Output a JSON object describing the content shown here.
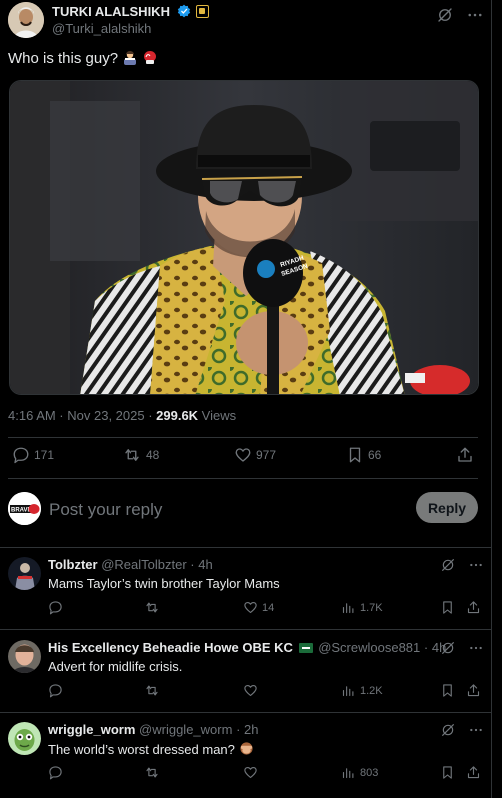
{
  "post": {
    "author_name": "TURKI ALALSHIKH",
    "author_handle": "@Turki_alalshikh",
    "text": "Who is this guy?",
    "timestamp": "4:16 AM · Nov 23, 2025 · ",
    "views_count": "299.6K",
    "views_label": " Views",
    "replies": "171",
    "reposts": "48",
    "likes": "977",
    "bookmarks": "66",
    "photo_caption": "RIYADH SEASON"
  },
  "composer": {
    "placeholder": "Post your reply",
    "reply_button": "Reply",
    "avatar_text": "BRAVE"
  },
  "replies": [
    {
      "name": "Tolbzter",
      "handle": "@RealTolbzter",
      "time": "· 4h",
      "text": "Mams Taylor’s twin brother Taylor Mams",
      "likes": "14",
      "views": "1.7K"
    },
    {
      "name": "His Excellency Beheadie Howe OBE KC",
      "handle": "@Screwloose881",
      "time": "· 4h",
      "text": "Advert for midlife crisis.",
      "likes": "",
      "views": "1.2K"
    },
    {
      "name": "wriggle_worm",
      "handle": "@wriggle_worm",
      "time": "· 2h",
      "text": "The world’s worst dressed man?",
      "likes": "",
      "views": "803"
    }
  ],
  "colors": {
    "background": "#000000",
    "text": "#e7e9ea",
    "muted": "#71767b",
    "verified": "#1d9bf0",
    "border": "#2f3336"
  }
}
